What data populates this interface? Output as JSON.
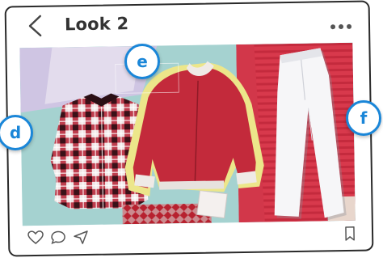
{
  "post": {
    "title": "Look 2"
  },
  "tags": [
    {
      "label": "d"
    },
    {
      "label": "e"
    },
    {
      "label": "f"
    }
  ],
  "icons": {
    "back": "chevron-left-icon",
    "more": "more-dots-icon",
    "like": "heart-icon",
    "comment": "comment-icon",
    "share": "send-icon",
    "save": "bookmark-icon"
  },
  "colors": {
    "tag_accent": "#1a86d8",
    "jacket": "#c3283a",
    "background_stripes": "#d63145",
    "shirt_check": "#b0202e"
  }
}
